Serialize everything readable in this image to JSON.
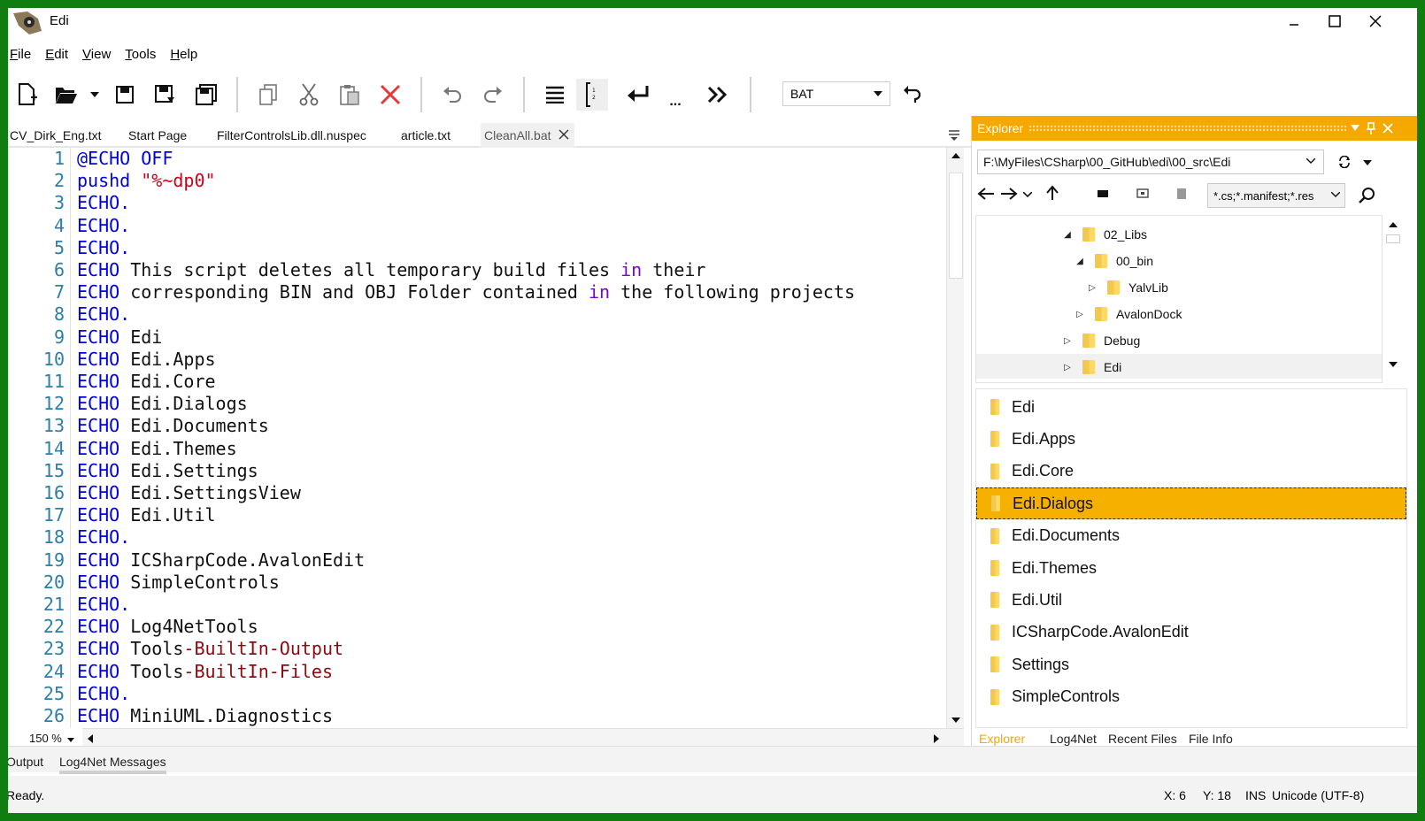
{
  "window": {
    "title": "Edi"
  },
  "menu": [
    {
      "label": "File",
      "accel": "F",
      "rest": "ile"
    },
    {
      "label": "Edit",
      "accel": "E",
      "rest": "dit"
    },
    {
      "label": "View",
      "accel": "V",
      "rest": "iew"
    },
    {
      "label": "Tools",
      "accel": "T",
      "rest": "ools"
    },
    {
      "label": "Help",
      "accel": "H",
      "rest": "elp"
    }
  ],
  "toolbar": {
    "icons": [
      "new-file-icon",
      "open-folder-icon",
      "dropdown-arrow-icon",
      "save-icon",
      "save-as-icon",
      "save-all-icon",
      "copy-icon",
      "cut-icon",
      "paste-icon",
      "delete-icon",
      "undo-icon",
      "redo-icon",
      "word-wrap-icon",
      "line-numbers-icon",
      "newline-icon",
      "whitespace-icon",
      "show-more-icon",
      "rotate-icon"
    ],
    "highlighting": "BAT",
    "ellipsis": "..."
  },
  "tabs": [
    "CV_Dirk_Eng.txt",
    "Start Page",
    "FilterControlsLib.dll.nuspec",
    "article.txt",
    "CleanAll.bat"
  ],
  "active_tab": "CleanAll.bat",
  "editor": {
    "zoom": "150 %",
    "lines": [
      [
        {
          "t": "@ECHO OFF",
          "c": "kw"
        }
      ],
      [
        {
          "t": "pushd ",
          "c": "kw"
        },
        {
          "t": "\"%~dp0\"",
          "c": "str"
        }
      ],
      [
        {
          "t": "ECHO.",
          "c": "kw"
        }
      ],
      [
        {
          "t": "ECHO.",
          "c": "kw"
        }
      ],
      [
        {
          "t": "ECHO.",
          "c": "kw"
        }
      ],
      [
        {
          "t": "ECHO",
          "c": "kw"
        },
        {
          "t": " This script deletes all temporary build files ",
          "c": ""
        },
        {
          "t": "in",
          "c": "kwp"
        },
        {
          "t": " their",
          "c": ""
        }
      ],
      [
        {
          "t": "ECHO",
          "c": "kw"
        },
        {
          "t": " corresponding BIN and OBJ Folder contained ",
          "c": ""
        },
        {
          "t": "in",
          "c": "kwp"
        },
        {
          "t": " the following projects",
          "c": ""
        }
      ],
      [
        {
          "t": "ECHO.",
          "c": "kw"
        }
      ],
      [
        {
          "t": "ECHO",
          "c": "kw"
        },
        {
          "t": " Edi",
          "c": ""
        }
      ],
      [
        {
          "t": "ECHO",
          "c": "kw"
        },
        {
          "t": " Edi.Apps",
          "c": ""
        }
      ],
      [
        {
          "t": "ECHO",
          "c": "kw"
        },
        {
          "t": " Edi.Core",
          "c": ""
        }
      ],
      [
        {
          "t": "ECHO",
          "c": "kw"
        },
        {
          "t": " Edi.Dialogs",
          "c": ""
        }
      ],
      [
        {
          "t": "ECHO",
          "c": "kw"
        },
        {
          "t": " Edi.Documents",
          "c": ""
        }
      ],
      [
        {
          "t": "ECHO",
          "c": "kw"
        },
        {
          "t": " Edi.Themes",
          "c": ""
        }
      ],
      [
        {
          "t": "ECHO",
          "c": "kw"
        },
        {
          "t": " Edi.Settings",
          "c": ""
        }
      ],
      [
        {
          "t": "ECHO",
          "c": "kw"
        },
        {
          "t": " Edi.SettingsView",
          "c": ""
        }
      ],
      [
        {
          "t": "ECHO",
          "c": "kw"
        },
        {
          "t": " Edi.Util",
          "c": ""
        }
      ],
      [
        {
          "t": "ECHO.",
          "c": "kw"
        }
      ],
      [
        {
          "t": "ECHO",
          "c": "kw"
        },
        {
          "t": " ICSharpCode.AvalonEdit",
          "c": ""
        }
      ],
      [
        {
          "t": "ECHO",
          "c": "kw"
        },
        {
          "t": " SimpleControls",
          "c": ""
        }
      ],
      [
        {
          "t": "ECHO.",
          "c": "kw"
        }
      ],
      [
        {
          "t": "ECHO",
          "c": "kw"
        },
        {
          "t": " Log4NetTools",
          "c": ""
        }
      ],
      [
        {
          "t": "ECHO",
          "c": "kw"
        },
        {
          "t": " Tools",
          "c": ""
        },
        {
          "t": "-BuiltIn-Output",
          "c": "opt"
        }
      ],
      [
        {
          "t": "ECHO",
          "c": "kw"
        },
        {
          "t": " Tools",
          "c": ""
        },
        {
          "t": "-BuiltIn-Files",
          "c": "opt"
        }
      ],
      [
        {
          "t": "ECHO.",
          "c": "kw"
        }
      ],
      [
        {
          "t": "ECHO",
          "c": "kw"
        },
        {
          "t": " MiniUML.Diagnostics",
          "c": ""
        }
      ]
    ]
  },
  "bottom_tabs": [
    "Output",
    "Log4Net Messages"
  ],
  "status": {
    "text": "Ready.",
    "x": "X: 6",
    "y": "Y: 18",
    "mode": "INS",
    "encoding": "Unicode (UTF-8)"
  },
  "explorer": {
    "title": "Explorer",
    "path": "F:\\MyFiles\\CSharp\\00_GitHub\\edi\\00_src\\Edi",
    "filter": "*.cs;*.manifest;*.res",
    "tree": [
      {
        "label": "02_Libs",
        "level": 0,
        "expanded": true
      },
      {
        "label": "00_bin",
        "level": 1,
        "expanded": true
      },
      {
        "label": "YalvLib",
        "level": 2,
        "expanded": false
      },
      {
        "label": "AvalonDock",
        "level": 1,
        "expanded": false
      },
      {
        "label": "Debug",
        "level": 0,
        "expanded": false
      },
      {
        "label": "Edi",
        "level": 0,
        "expanded": false
      }
    ],
    "folders": [
      "Edi",
      "Edi.Apps",
      "Edi.Core",
      "Edi.Dialogs",
      "Edi.Documents",
      "Edi.Themes",
      "Edi.Util",
      "ICSharpCode.AvalonEdit",
      "Settings",
      "SimpleControls"
    ],
    "selected_folder": "Edi.Dialogs",
    "tabs": [
      "Explorer",
      "Log4Net",
      "Recent Files",
      "File Info"
    ],
    "active_tab": "Explorer"
  },
  "colors": {
    "accent": "#f5a900",
    "keyword": "#0000e0",
    "string": "#d0001a",
    "frame": "#0f7d0f"
  }
}
